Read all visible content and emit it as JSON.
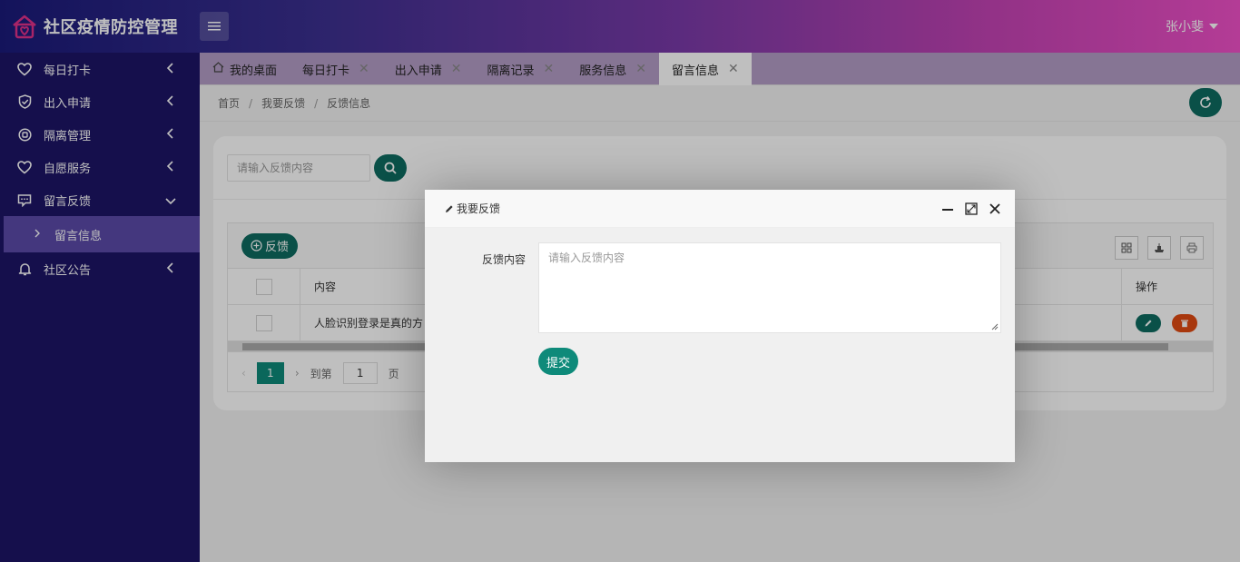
{
  "app": {
    "title": "社区疫情防控管理",
    "user": "张小斐"
  },
  "sidebar": {
    "items": [
      {
        "label": "每日打卡",
        "icon": "heart-icon"
      },
      {
        "label": "出入申请",
        "icon": "shield-check-icon"
      },
      {
        "label": "隔离管理",
        "icon": "target-icon"
      },
      {
        "label": "自愿服务",
        "icon": "heart-icon"
      },
      {
        "label": "留言反馈",
        "icon": "message-icon",
        "expanded": true
      },
      {
        "label": "社区公告",
        "icon": "bell-icon"
      }
    ],
    "sub_item": {
      "label": "留言信息"
    }
  },
  "tabs": [
    {
      "label": "我的桌面",
      "icon": "home-icon"
    },
    {
      "label": "每日打卡"
    },
    {
      "label": "出入申请"
    },
    {
      "label": "隔离记录"
    },
    {
      "label": "服务信息"
    },
    {
      "label": "留言信息",
      "active": true
    }
  ],
  "breadcrumb": {
    "home": "首页",
    "parent": "我要反馈",
    "current": "反馈信息"
  },
  "search": {
    "placeholder": "请输入反馈内容"
  },
  "table": {
    "add_label": "反馈",
    "columns": {
      "content": "内容",
      "ops": "操作"
    },
    "rows": [
      {
        "content": "人脸识别登录是真的方"
      }
    ]
  },
  "pager": {
    "current": "1",
    "goto_label": "到第",
    "goto_value": "1",
    "page_unit": "页"
  },
  "dialog": {
    "title": "我要反馈",
    "field_label": "反馈内容",
    "placeholder": "请输入反馈内容",
    "submit": "提交"
  },
  "colors": {
    "primary": "#0e6b60",
    "danger": "#e04a12",
    "sidebar": "#1c1466",
    "sidebar_active": "#5b4aa8"
  }
}
